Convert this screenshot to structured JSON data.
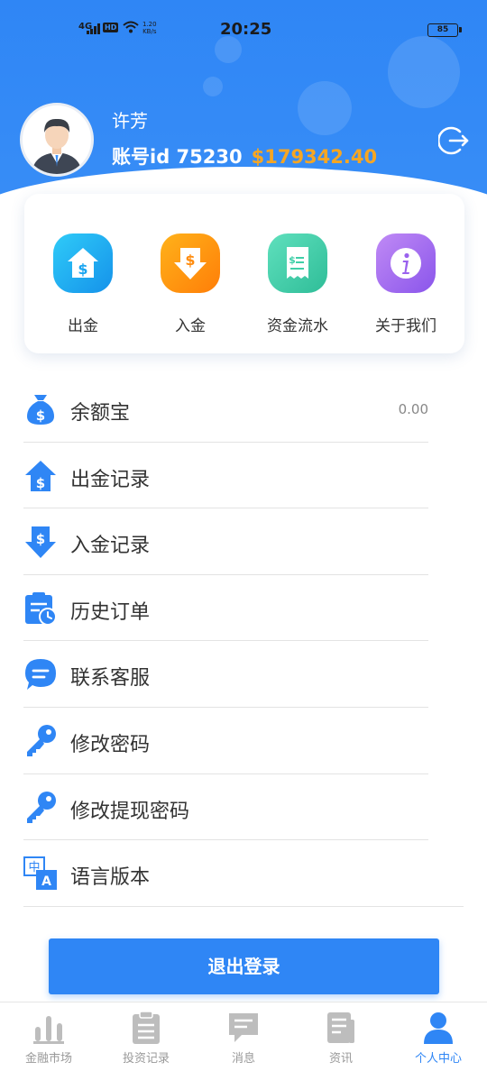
{
  "status_bar": {
    "network": "4G",
    "hd": "HD",
    "speed_value": "1.20",
    "speed_unit": "KB/s",
    "time": "20:25",
    "battery": "85"
  },
  "profile": {
    "username": "许芳",
    "account_label": "账号id 75230",
    "balance": "$179342.40"
  },
  "quick_actions": [
    {
      "label": "出金",
      "icon": "withdraw-house-icon",
      "color": "#1fb6f0"
    },
    {
      "label": "入金",
      "icon": "deposit-arrow-icon",
      "color": "#ff9a10"
    },
    {
      "label": "资金流水",
      "icon": "receipt-icon",
      "color": "#3fcfa8"
    },
    {
      "label": "关于我们",
      "icon": "info-icon",
      "color": "#a06cf0"
    }
  ],
  "menu": [
    {
      "label": "余额宝",
      "value": "0.00",
      "icon": "money-bag-icon"
    },
    {
      "label": "出金记录",
      "value": "",
      "icon": "withdraw-record-icon"
    },
    {
      "label": "入金记录",
      "value": "",
      "icon": "deposit-record-icon"
    },
    {
      "label": "历史订单",
      "value": "",
      "icon": "history-order-icon"
    },
    {
      "label": "联系客服",
      "value": "",
      "icon": "chat-bubble-icon"
    },
    {
      "label": "修改密码",
      "value": "",
      "icon": "key-icon"
    },
    {
      "label": "修改提现密码",
      "value": "",
      "icon": "key-icon"
    },
    {
      "label": "语言版本",
      "value": "",
      "icon": "language-icon"
    }
  ],
  "logout_button": "退出登录",
  "tabs": [
    {
      "label": "金融市场",
      "icon": "bar-chart-icon",
      "active": false
    },
    {
      "label": "投资记录",
      "icon": "clipboard-icon",
      "active": false
    },
    {
      "label": "消息",
      "icon": "message-icon",
      "active": false
    },
    {
      "label": "资讯",
      "icon": "news-icon",
      "active": false
    },
    {
      "label": "个人中心",
      "icon": "person-icon",
      "active": true
    }
  ],
  "colors": {
    "primary": "#2f86f5",
    "balance": "#f6a623",
    "inactive_tab": "#999999"
  }
}
